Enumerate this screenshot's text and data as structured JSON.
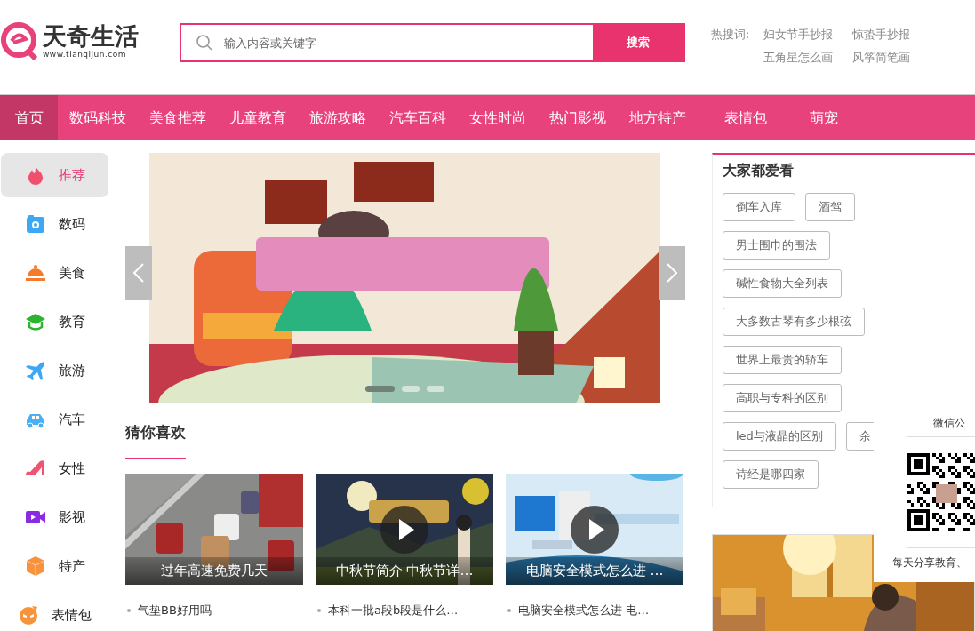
{
  "logo": {
    "name": "天奇生活",
    "domain": "www.tianqijun.com"
  },
  "search": {
    "placeholder": "输入内容或关键字",
    "button": "搜索"
  },
  "hot_search": {
    "label": "热搜词:",
    "terms": [
      "妇女节手抄报",
      "惊蛰手抄报",
      "五角星怎么画",
      "风筝简笔画"
    ]
  },
  "nav": [
    {
      "label": "首页",
      "selected": true
    },
    {
      "label": "数码科技",
      "selected": false
    },
    {
      "label": "美食推荐",
      "selected": false
    },
    {
      "label": "儿童教育",
      "selected": false
    },
    {
      "label": "旅游攻略",
      "selected": false
    },
    {
      "label": "汽车百科",
      "selected": false
    },
    {
      "label": "女性时尚",
      "selected": false
    },
    {
      "label": "热门影视",
      "selected": false
    },
    {
      "label": "地方特产",
      "selected": false
    },
    {
      "label": "表情包",
      "selected": false
    },
    {
      "label": "萌宠",
      "selected": false
    }
  ],
  "sidebar": [
    {
      "label": "推荐",
      "kind": "flame",
      "selected": true
    },
    {
      "label": "数码",
      "kind": "camera",
      "selected": false
    },
    {
      "label": "美食",
      "kind": "dish",
      "selected": false
    },
    {
      "label": "教育",
      "kind": "cap",
      "selected": false
    },
    {
      "label": "旅游",
      "kind": "plane",
      "selected": false
    },
    {
      "label": "汽车",
      "kind": "car",
      "selected": false
    },
    {
      "label": "女性",
      "kind": "shoe",
      "selected": false
    },
    {
      "label": "影视",
      "kind": "video",
      "selected": false
    },
    {
      "label": "特产",
      "kind": "box",
      "selected": false
    },
    {
      "label": "表情包",
      "kind": "face",
      "selected": false
    }
  ],
  "banner": {
    "dots": [
      {
        "selected": true
      },
      {
        "selected": false
      },
      {
        "selected": false
      }
    ]
  },
  "guess": {
    "title": "猜你喜欢",
    "cards": [
      {
        "caption": "过年高速免费几天",
        "video": false
      },
      {
        "caption": "中秋节简介 中秋节详…",
        "video": true
      },
      {
        "caption": "电脑安全模式怎么进 …",
        "video": true
      }
    ],
    "links": [
      "气垫BB好用吗",
      "本科一批a段b段是什么…",
      "电脑安全模式怎么进 电…"
    ]
  },
  "popular": {
    "title": "大家都爱看",
    "tag_rows": [
      [
        "倒车入库",
        "酒驾"
      ],
      [
        "男士围巾的围法"
      ],
      [
        "碱性食物大全列表"
      ],
      [
        "大多数古琴有多少根弦"
      ],
      [
        "世界上最贵的轿车"
      ],
      [
        "高职与专科的区别"
      ],
      [
        "led与液晶的区别",
        "余"
      ],
      [
        "诗经是哪四家"
      ]
    ]
  },
  "wechat_popup": {
    "title": "微信公",
    "caption": "每天分享教育、"
  }
}
